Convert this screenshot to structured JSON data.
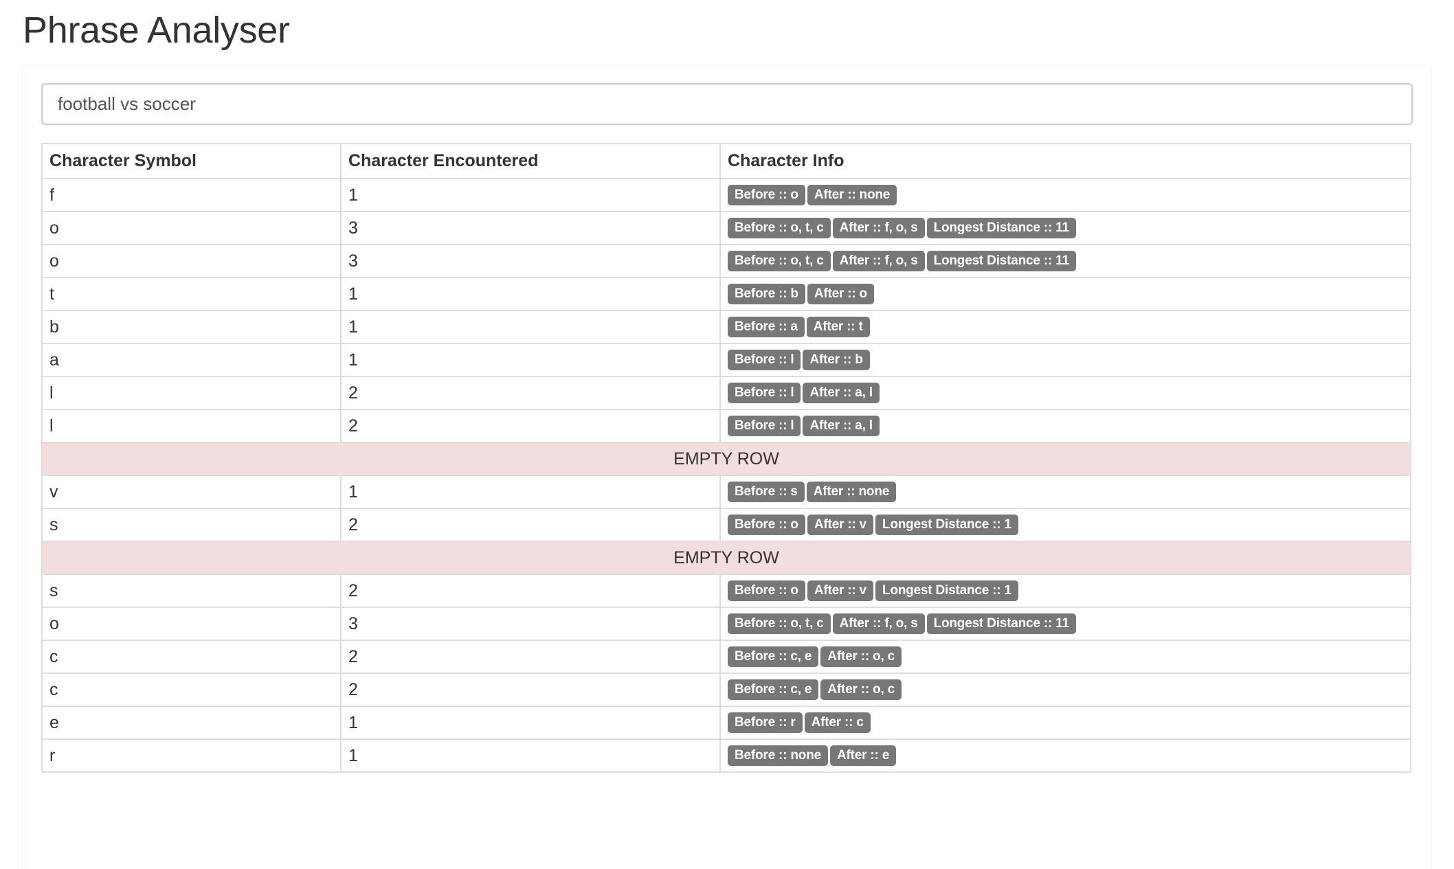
{
  "page": {
    "title": "Phrase Analyser"
  },
  "search": {
    "value": "football vs soccer",
    "placeholder": ""
  },
  "table": {
    "headers": [
      "Character Symbol",
      "Character Encountered",
      "Character Info"
    ],
    "empty_row_label": "EMPTY ROW",
    "rows": [
      {
        "type": "char",
        "symbol": "f",
        "count": "1",
        "badges": [
          "Before :: o",
          "After :: none"
        ]
      },
      {
        "type": "char",
        "symbol": "o",
        "count": "3",
        "badges": [
          "Before :: o, t, c",
          "After :: f, o, s",
          "Longest Distance :: 11"
        ]
      },
      {
        "type": "char",
        "symbol": "o",
        "count": "3",
        "badges": [
          "Before :: o, t, c",
          "After :: f, o, s",
          "Longest Distance :: 11"
        ]
      },
      {
        "type": "char",
        "symbol": "t",
        "count": "1",
        "badges": [
          "Before :: b",
          "After :: o"
        ]
      },
      {
        "type": "char",
        "symbol": "b",
        "count": "1",
        "badges": [
          "Before :: a",
          "After :: t"
        ]
      },
      {
        "type": "char",
        "symbol": "a",
        "count": "1",
        "badges": [
          "Before :: l",
          "After :: b"
        ]
      },
      {
        "type": "char",
        "symbol": "l",
        "count": "2",
        "badges": [
          "Before :: l",
          "After :: a, l"
        ]
      },
      {
        "type": "char",
        "symbol": "l",
        "count": "2",
        "badges": [
          "Before :: l",
          "After :: a, l"
        ]
      },
      {
        "type": "empty"
      },
      {
        "type": "char",
        "symbol": "v",
        "count": "1",
        "badges": [
          "Before :: s",
          "After :: none"
        ]
      },
      {
        "type": "char",
        "symbol": "s",
        "count": "2",
        "badges": [
          "Before :: o",
          "After :: v",
          "Longest Distance :: 1"
        ]
      },
      {
        "type": "empty"
      },
      {
        "type": "char",
        "symbol": "s",
        "count": "2",
        "badges": [
          "Before :: o",
          "After :: v",
          "Longest Distance :: 1"
        ]
      },
      {
        "type": "char",
        "symbol": "o",
        "count": "3",
        "badges": [
          "Before :: o, t, c",
          "After :: f, o, s",
          "Longest Distance :: 11"
        ]
      },
      {
        "type": "char",
        "symbol": "c",
        "count": "2",
        "badges": [
          "Before :: c, e",
          "After :: o, c"
        ]
      },
      {
        "type": "char",
        "symbol": "c",
        "count": "2",
        "badges": [
          "Before :: c, e",
          "After :: o, c"
        ]
      },
      {
        "type": "char",
        "symbol": "e",
        "count": "1",
        "badges": [
          "Before :: r",
          "After :: c"
        ]
      },
      {
        "type": "char",
        "symbol": "r",
        "count": "1",
        "badges": [
          "Before :: none",
          "After :: e"
        ]
      }
    ]
  },
  "colors": {
    "badge_bg": "#777777",
    "empty_row_bg": "#f2dede",
    "border": "#dddddd"
  }
}
